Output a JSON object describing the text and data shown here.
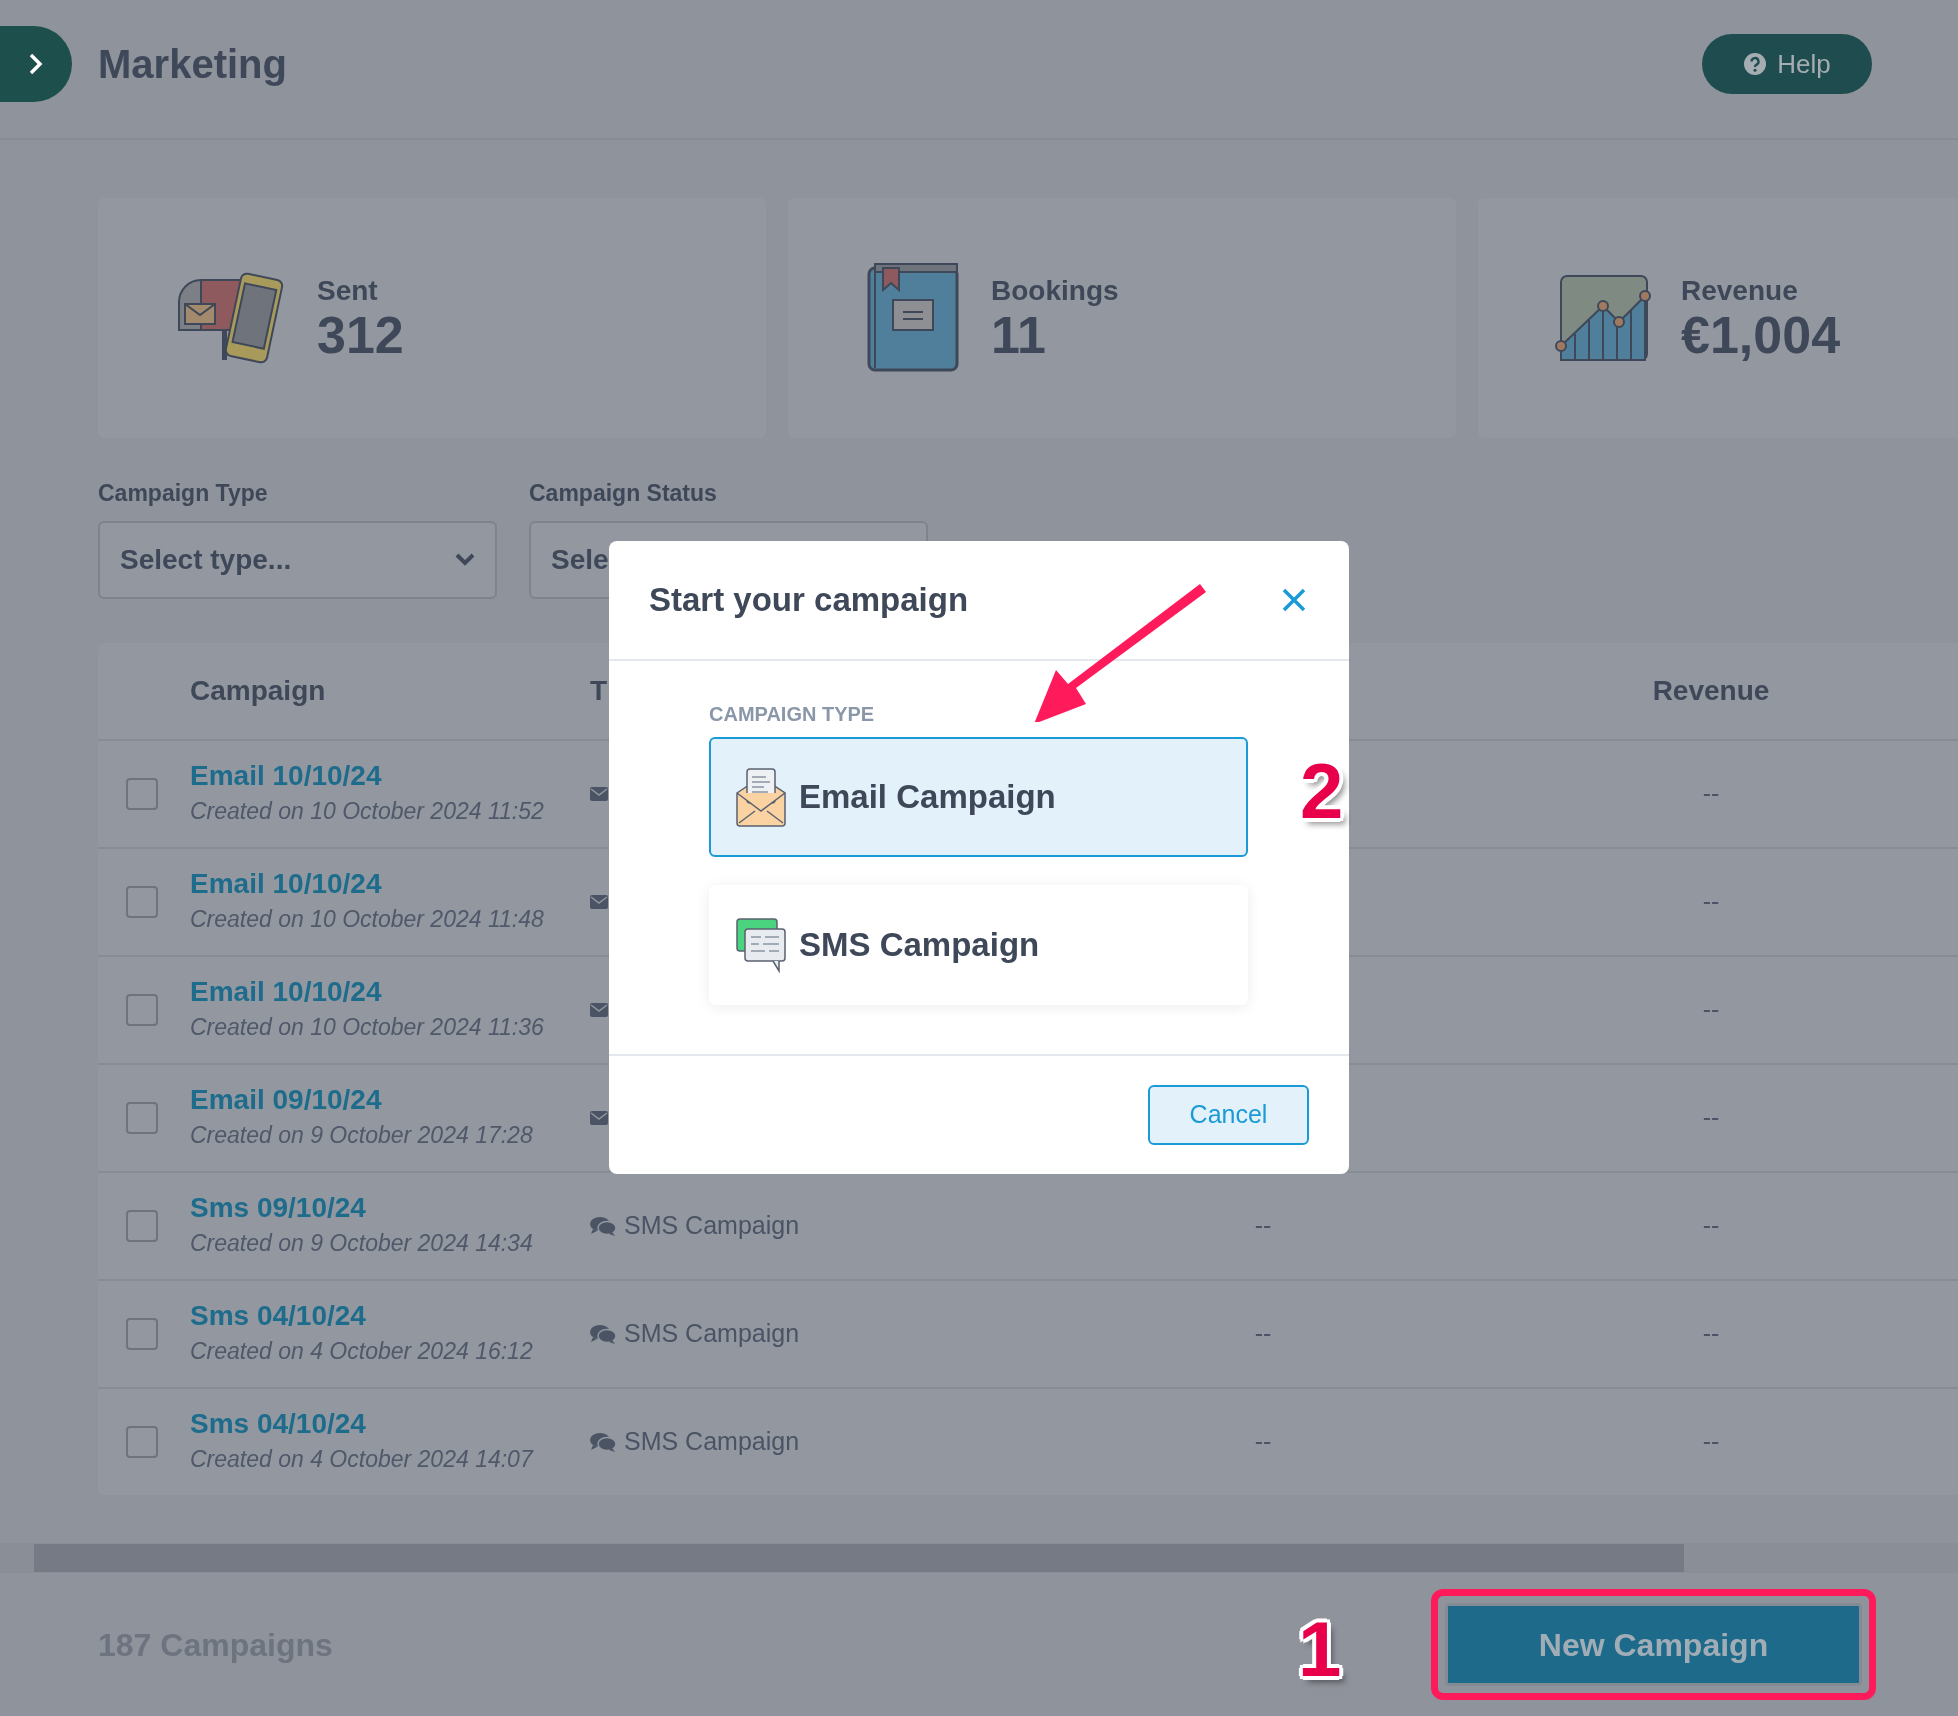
{
  "header": {
    "title": "Marketing",
    "help_button": "Help"
  },
  "stats": [
    {
      "kind": "mailbox",
      "label": "Sent",
      "value": "312"
    },
    {
      "kind": "book",
      "label": "Bookings",
      "value": "11"
    },
    {
      "kind": "chart",
      "label": "Revenue",
      "value": "€1,004"
    }
  ],
  "filters": [
    {
      "label": "Campaign Type",
      "placeholder": "Select type..."
    },
    {
      "label": "Campaign Status",
      "placeholder": "Sele"
    }
  ],
  "table": {
    "columns": [
      "Campaign",
      "T",
      "",
      "Revenue"
    ],
    "rows": [
      {
        "name": "Email 10/10/24",
        "created": "Created on 10 October 2024 11:52",
        "kind": "email",
        "checked": false,
        "revenue": "--"
      },
      {
        "name": "Email 10/10/24",
        "created": "Created on 10 October 2024 11:48",
        "kind": "email",
        "checked": false,
        "revenue": "--"
      },
      {
        "name": "Email 10/10/24",
        "created": "Created on 10 October 2024 11:36",
        "kind": "email",
        "checked": false,
        "revenue": "--"
      },
      {
        "name": "Email 09/10/24",
        "created": "Created on 9 October 2024 17:28",
        "kind": "email",
        "checked": false,
        "revenue": "--"
      },
      {
        "name": "Sms 09/10/24",
        "created": "Created on 9 October 2024 14:34",
        "kind": "sms",
        "type": "SMS Campaign",
        "column_3": "--",
        "checked": false,
        "revenue": "--"
      },
      {
        "name": "Sms 04/10/24",
        "created": "Created on 4 October 2024 16:12",
        "kind": "sms",
        "type": "SMS Campaign",
        "column_3": "--",
        "checked": false,
        "revenue": "--"
      },
      {
        "name": "Sms 04/10/24",
        "created": "Created on 4 October 2024 14:07",
        "kind": "sms",
        "type": "SMS Campaign",
        "column_3": "--",
        "checked": false,
        "revenue": "--"
      }
    ]
  },
  "footer": {
    "count": "187 Campaigns",
    "new_campaign": {
      "label": "New Campaign",
      "highlighted": true
    }
  },
  "modal": {
    "title": "Start your campaign",
    "section_label": "CAMPAIGN TYPE",
    "options": [
      {
        "label": "Email Campaign",
        "kind": "email",
        "selected": true
      },
      {
        "label": "SMS Campaign",
        "kind": "sms",
        "selected": false
      }
    ],
    "cancel_button": "Cancel"
  },
  "annotations": [
    {
      "kind": "arrow"
    },
    {
      "kind": "step",
      "label": "2"
    },
    {
      "kind": "step",
      "label": "1"
    }
  ]
}
